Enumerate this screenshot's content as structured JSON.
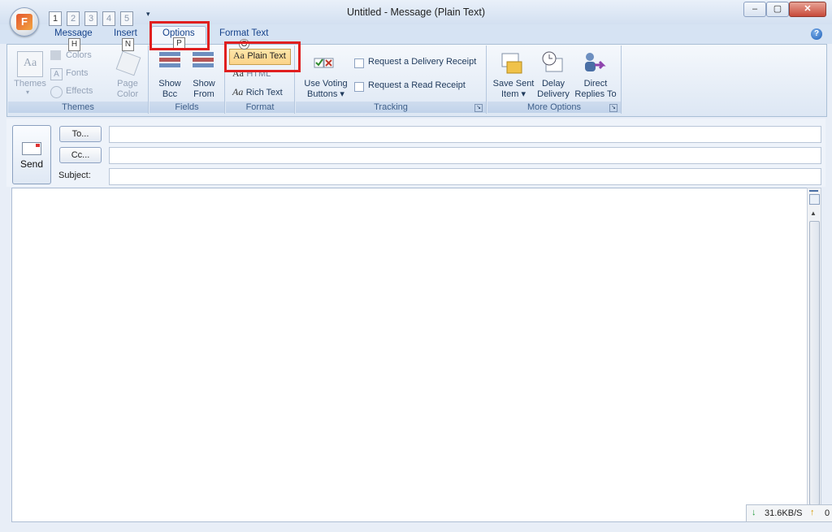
{
  "window": {
    "title": "Untitled - Message (Plain Text)",
    "minimize": "–",
    "restore": "▢",
    "close": "✕"
  },
  "orb": {
    "letter": "F"
  },
  "qat_keytips": [
    "1",
    "2",
    "3",
    "4",
    "5"
  ],
  "tabs": {
    "message": "Message",
    "insert": "Insert",
    "options": "Options",
    "format_text": "Format Text",
    "keytip_message": "H",
    "keytip_insert": "N",
    "keytip_options": "P",
    "keytip_plain": "O"
  },
  "groups": {
    "themes": {
      "label": "Themes",
      "themes_btn": "Themes",
      "colors": "Colors",
      "fonts": "Fonts",
      "effects": "Effects",
      "page_color_1": "Page",
      "page_color_2": "Color"
    },
    "fields": {
      "label": "Fields",
      "show_bcc_1": "Show",
      "show_bcc_2": "Bcc",
      "show_from_1": "Show",
      "show_from_2": "From"
    },
    "format": {
      "label": "Format",
      "plain_text": "Plain Text",
      "html": "HTML",
      "rich_text": "Rich Text"
    },
    "tracking": {
      "label": "Tracking",
      "voting_1": "Use Voting",
      "voting_2": "Buttons",
      "delivery_receipt": "Request a Delivery Receipt",
      "read_receipt": "Request a Read Receipt"
    },
    "more_options": {
      "label": "More Options",
      "save_sent_1": "Save Sent",
      "save_sent_2": "Item",
      "delay_1": "Delay",
      "delay_2": "Delivery",
      "direct_1": "Direct",
      "direct_2": "Replies To"
    }
  },
  "compose": {
    "send": "Send",
    "to": "To...",
    "cc": "Cc...",
    "subject": "Subject:",
    "to_value": "",
    "cc_value": "",
    "subject_value": "",
    "body": ""
  },
  "status": {
    "download": "31.6KB/S",
    "upload": "0"
  },
  "colors": {
    "highlight": "#e01f1f",
    "selected_format": "#fbd38a"
  }
}
